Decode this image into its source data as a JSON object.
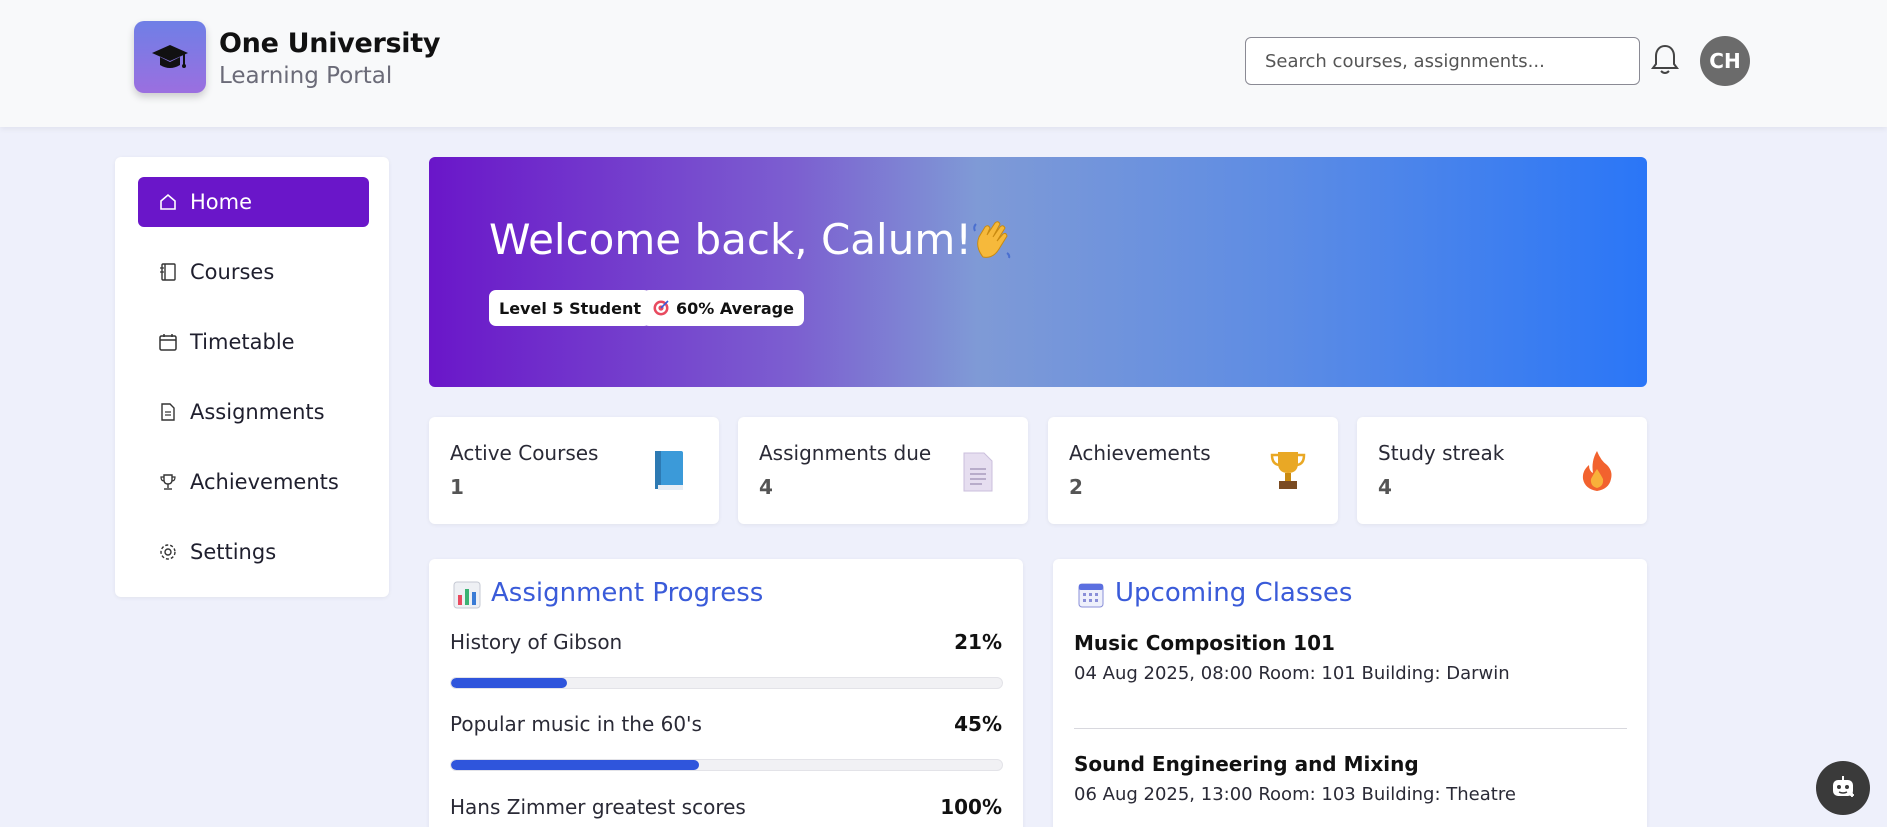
{
  "brand": {
    "title": "One University",
    "subtitle": "Learning Portal"
  },
  "search": {
    "placeholder": "Search courses, assignments..."
  },
  "user": {
    "initials": "CH"
  },
  "sidebar": {
    "items": [
      {
        "label": "Home",
        "icon": "home-icon",
        "active": true
      },
      {
        "label": "Courses",
        "icon": "book-icon",
        "active": false
      },
      {
        "label": "Timetable",
        "icon": "calendar-icon",
        "active": false
      },
      {
        "label": "Assignments",
        "icon": "document-icon",
        "active": false
      },
      {
        "label": "Achievements",
        "icon": "trophy-icon",
        "active": false
      },
      {
        "label": "Settings",
        "icon": "gear-icon",
        "active": false
      }
    ]
  },
  "hero": {
    "welcome": "Welcome back, Calum!",
    "level": "Level 5 Student",
    "average": "60% Average"
  },
  "stats": [
    {
      "label": "Active Courses",
      "value": "1",
      "icon": "blue-book-icon"
    },
    {
      "label": "Assignments due",
      "value": "4",
      "icon": "page-icon"
    },
    {
      "label": "Achievements",
      "value": "2",
      "icon": "trophy-icon"
    },
    {
      "label": "Study streak",
      "value": "4",
      "icon": "fire-icon"
    }
  ],
  "progress": {
    "title": "Assignment Progress",
    "items": [
      {
        "name": "History of Gibson",
        "percent_label": "21%",
        "percent": 21
      },
      {
        "name": "Popular music in the 60's",
        "percent_label": "45%",
        "percent": 45
      },
      {
        "name": "Hans Zimmer greatest scores",
        "percent_label": "100%",
        "percent": 100
      }
    ]
  },
  "classes": {
    "title": "Upcoming Classes",
    "items": [
      {
        "name": "Music Composition 101",
        "info": "04 Aug 2025, 08:00 Room: 101 Building: Darwin"
      },
      {
        "name": "Sound Engineering and Mixing",
        "info": "06 Aug 2025, 13:00 Room: 103 Building: Theatre"
      }
    ]
  },
  "colors": {
    "accent": "#6a16c9",
    "progress": "#2f55dc",
    "link_title": "#3a5bd9"
  }
}
